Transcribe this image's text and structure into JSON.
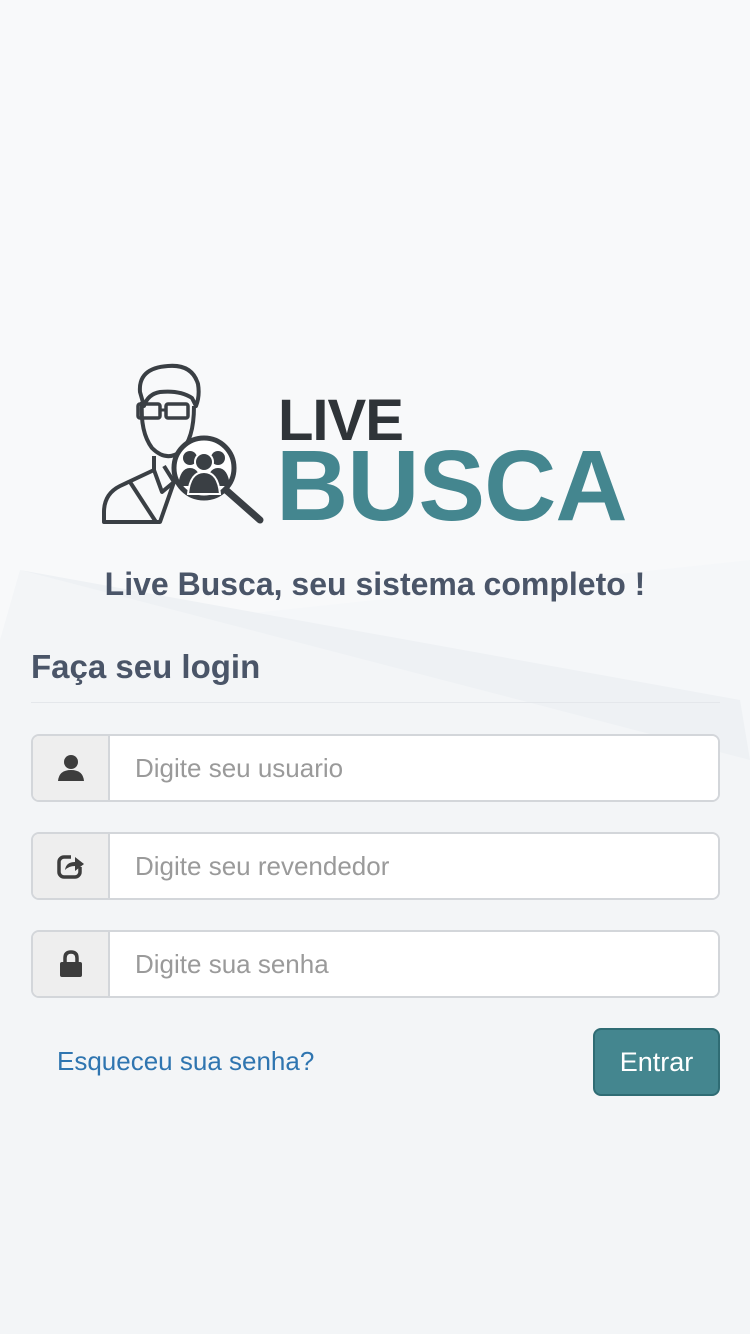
{
  "logo": {
    "line1": "LIVE",
    "line2": "BUSCA",
    "icon": "man-with-magnifier-logo"
  },
  "tagline": "Live Busca, seu sistema completo !",
  "login": {
    "title": "Faça seu login",
    "fields": [
      {
        "icon": "user-icon",
        "placeholder": "Digite seu usuario",
        "value": ""
      },
      {
        "icon": "share-icon",
        "placeholder": "Digite seu revendedor",
        "value": ""
      },
      {
        "icon": "lock-icon",
        "placeholder": "Digite sua senha",
        "value": ""
      }
    ],
    "forgot_label": "Esqueceu sua senha?",
    "submit_label": "Entrar"
  },
  "colors": {
    "brand": "#44868f",
    "text": "#4a5568",
    "link": "#2f75b0"
  }
}
